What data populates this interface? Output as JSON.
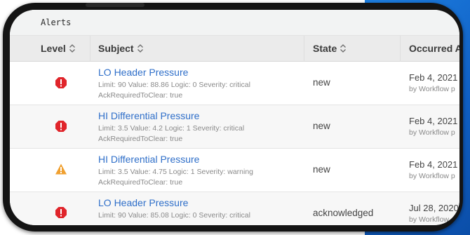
{
  "panel": {
    "title": "Alerts"
  },
  "table": {
    "columns": [
      {
        "label": "Level"
      },
      {
        "label": "Subject"
      },
      {
        "label": "State"
      },
      {
        "label": "Occurred At"
      }
    ],
    "rows": [
      {
        "level": "critical",
        "subject": "LO Header Pressure",
        "detail_line1": "Limit: 90 Value: 88.86 Logic: 0 Severity: critical",
        "detail_line2": "AckRequiredToClear: true",
        "state": "new",
        "occurred": "Feb 4, 2021",
        "by": "by Workflow p"
      },
      {
        "level": "critical",
        "subject": "HI Differential Pressure",
        "detail_line1": "Limit: 3.5 Value: 4.2 Logic: 1 Severity: critical",
        "detail_line2": "AckRequiredToClear: true",
        "state": "new",
        "occurred": "Feb 4, 2021",
        "by": "by Workflow p"
      },
      {
        "level": "warning",
        "subject": "HI Differential Pressure",
        "detail_line1": "Limit: 3.5 Value: 4.75 Logic: 1 Severity: warning",
        "detail_line2": "AckRequiredToClear: true",
        "state": "new",
        "occurred": "Feb 4, 2021",
        "by": "by Workflow p"
      },
      {
        "level": "critical",
        "subject": "LO Header Pressure",
        "detail_line1": "Limit: 90 Value: 85.08 Logic: 0 Severity: critical",
        "detail_line2": "",
        "state": "acknowledged",
        "occurred": "Jul 28, 2020",
        "by": "by Workflow"
      }
    ]
  },
  "colors": {
    "critical": "#e0252b",
    "warning": "#f0a030",
    "link": "#2f6fc9"
  }
}
